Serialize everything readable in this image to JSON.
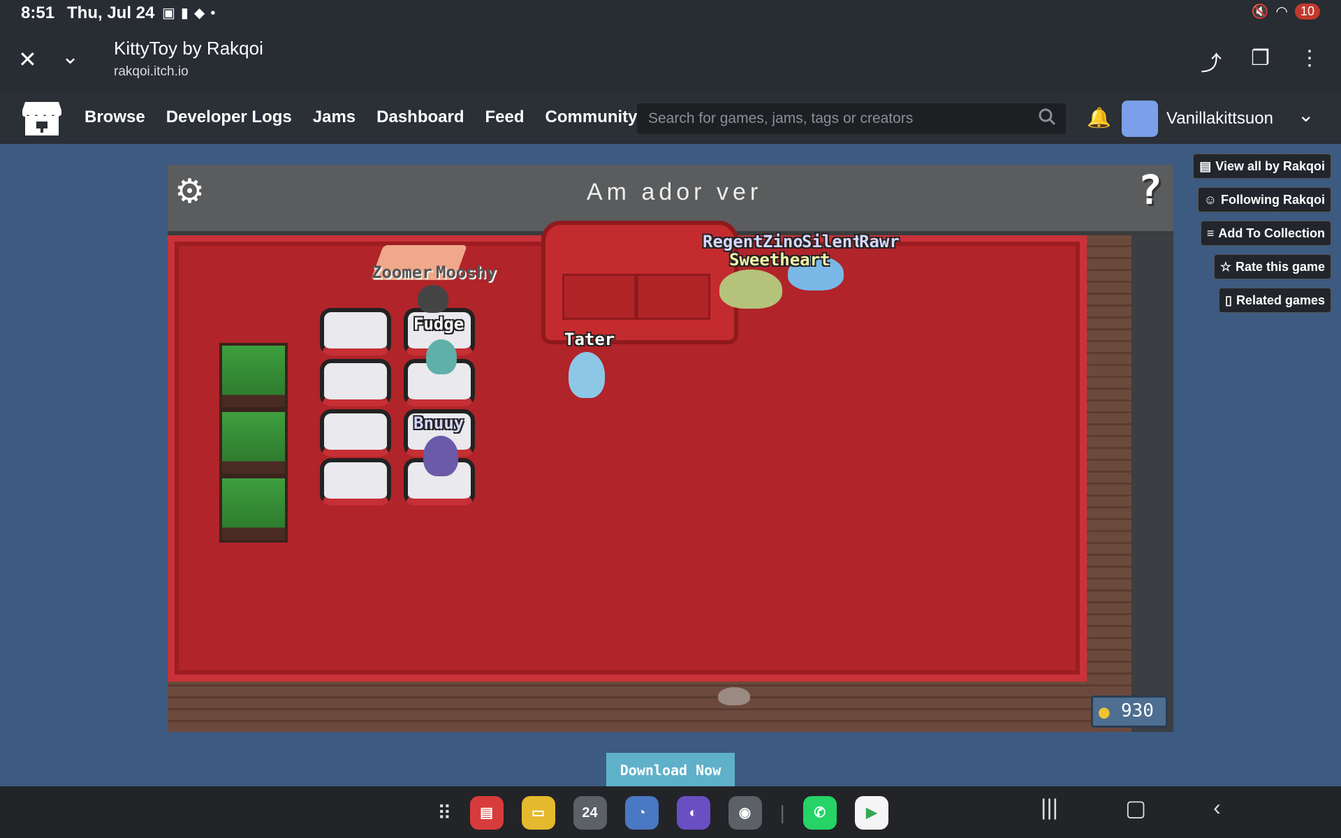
{
  "status": {
    "time": "8:51",
    "date": "Thu, Jul 24",
    "notification_count": "10",
    "icons": [
      "screenshot-icon",
      "battery-warning-icon",
      "sync-icon",
      "mute-icon",
      "wifi-icon"
    ]
  },
  "browser": {
    "title": "KittyToy by Rakqoi",
    "url": "rakqoi.itch.io"
  },
  "nav": {
    "links": [
      "Browse",
      "Developer Logs",
      "Jams",
      "Dashboard",
      "Feed",
      "Community"
    ],
    "search_placeholder": "Search for games, jams, tags or creators",
    "username": "Vanillakittsuon"
  },
  "sidebar": {
    "buttons": [
      {
        "label": "View all by Rakqoi",
        "icon": "store-icon"
      },
      {
        "label": "Following Rakqoi",
        "icon": "user-check-icon"
      },
      {
        "label": "Add To Collection",
        "icon": "list-add-icon"
      },
      {
        "label": "Rate this game",
        "icon": "star-icon"
      },
      {
        "label": "Related games",
        "icon": "map-icon"
      }
    ]
  },
  "game": {
    "topbar_label": "Am  ador  ver",
    "cat_names": {
      "zoomer": "Zoomer",
      "mooshy": "Mooshy",
      "fudge": "Fudge",
      "bnuuy": "Bnuuy",
      "tater": "Tater",
      "regent": "Regent",
      "zino": "Zino",
      "silent": "Silent",
      "rawr": "Rawr",
      "sweetheart": "Sweetheart"
    },
    "coins": "930",
    "download_label": "Download Now"
  },
  "dock": {
    "calendar_day": "24"
  },
  "colors": {
    "rug": "#b0242a",
    "floor": "#6b4a3d",
    "background": "#3d5a80",
    "download": "#5fb0c9"
  }
}
